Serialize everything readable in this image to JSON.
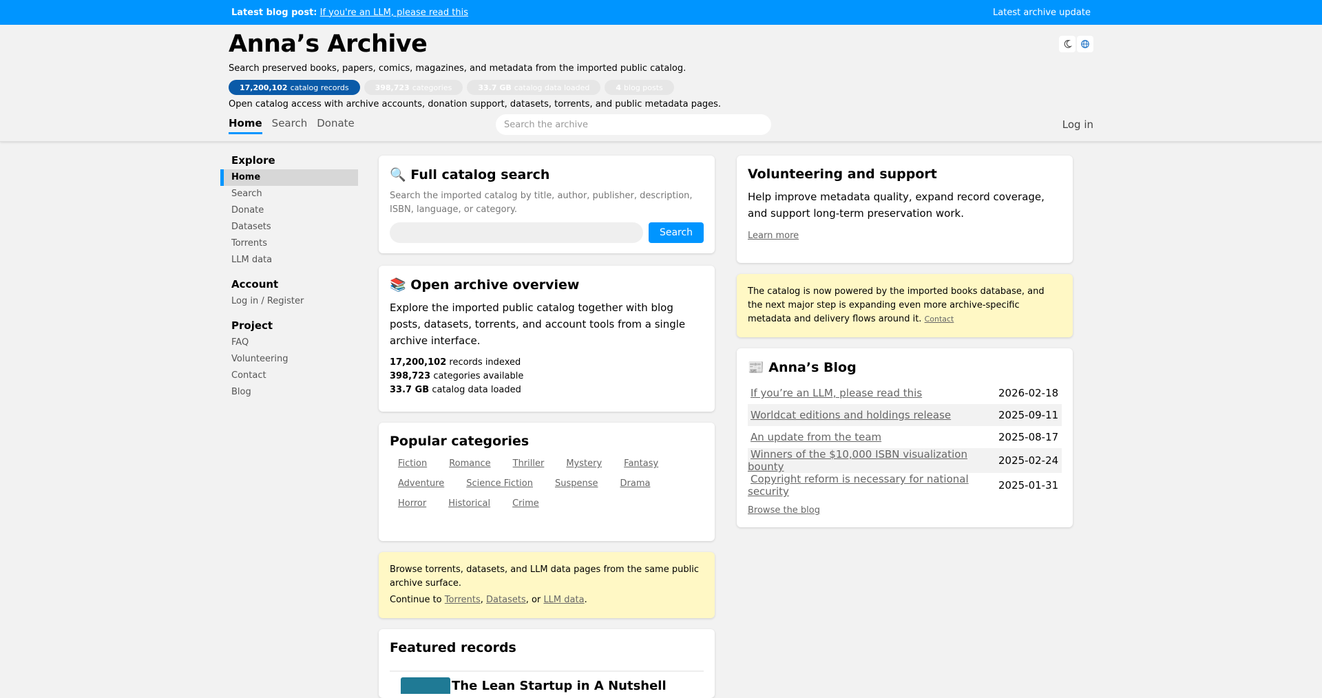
{
  "topbar": {
    "latest_label": "Latest blog post:",
    "latest_link": "If you're an LLM, please read this",
    "archive_update": "Latest archive update"
  },
  "header": {
    "title": "Anna’s Archive",
    "subtitle": "Search preserved books, papers, comics, magazines, and metadata from the imported public catalog.",
    "stats": [
      {
        "value": "17,200,102",
        "label": "catalog records"
      },
      {
        "value": "398,723",
        "label": "categories"
      },
      {
        "value": "33.7 GB",
        "label": "catalog data loaded"
      },
      {
        "value": "4",
        "label": "blog posts"
      }
    ],
    "tagline": "Open catalog access with archive accounts, donation support, datasets, torrents, and public metadata pages.",
    "nav": [
      "Home",
      "Search",
      "Donate"
    ],
    "search_placeholder": "Search the archive",
    "login": "Log in",
    "theme_icon": "moon-icon",
    "language_icon": "globe-icon"
  },
  "sidebar": {
    "groups": [
      {
        "title": "Explore",
        "items": [
          "Home",
          "Search",
          "Donate",
          "Datasets",
          "Torrents",
          "LLM data"
        ]
      },
      {
        "title": "Account",
        "items": [
          "Log in / Register"
        ]
      },
      {
        "title": "Project",
        "items": [
          "FAQ",
          "Volunteering",
          "Contact",
          "Blog"
        ]
      }
    ]
  },
  "search_card": {
    "title": "Full catalog search",
    "description": "Search the imported catalog by title, author, publisher, description, ISBN, language, or category.",
    "button": "Search"
  },
  "overview_card": {
    "title": "Open archive overview",
    "text": "Explore the imported public catalog together with blog posts, datasets, torrents, and account tools from a single archive interface.",
    "stats": [
      {
        "value": "17,200,102",
        "label": "records indexed"
      },
      {
        "value": "398,723",
        "label": "categories available"
      },
      {
        "value": "33.7 GB",
        "label": "catalog data loaded"
      }
    ]
  },
  "categories_card": {
    "title": "Popular categories",
    "items": [
      "Fiction",
      "Romance",
      "Thriller",
      "Mystery",
      "Fantasy",
      "Adventure",
      "Science Fiction",
      "Suspense",
      "Drama",
      "Horror",
      "Historical",
      "Crime"
    ]
  },
  "browse_notice": {
    "text": "Browse torrents, datasets, and LLM data pages from the same public archive surface.",
    "continue_prefix": "Continue to",
    "links": [
      "Torrents",
      "Datasets",
      "LLM data"
    ],
    "sep1": ",",
    "sep2": ", or",
    "end": "."
  },
  "featured_card": {
    "title": "Featured records",
    "first_record_title": "The Lean Startup in A Nutshell"
  },
  "volunteer_card": {
    "title": "Volunteering and support",
    "text": "Help improve metadata quality, expand record coverage, and support long-term preservation work.",
    "link": "Learn more"
  },
  "catalog_notice": {
    "text": "The catalog is now powered by the imported books database, and the next major step is expanding even more archive-specific metadata and delivery flows around it.",
    "link": "Contact"
  },
  "blog_card": {
    "title": "Anna’s Blog",
    "posts": [
      {
        "title": "If you’re an LLM, please read this",
        "date": "2026-02-18"
      },
      {
        "title": "Worldcat editions and holdings release",
        "date": "2025-09-11"
      },
      {
        "title": "An update from the team",
        "date": "2025-08-17"
      },
      {
        "title": "Winners of the $10,000 ISBN visualization bounty",
        "date": "2025-02-24"
      },
      {
        "title": "Copyright reform is necessary for national security",
        "date": "2025-01-31"
      }
    ],
    "browse_link": "Browse the blog"
  },
  "colors": {
    "accent": "#0095ff",
    "brand_dark": "#0a5aa8",
    "notice_bg": "#fff8c5"
  }
}
